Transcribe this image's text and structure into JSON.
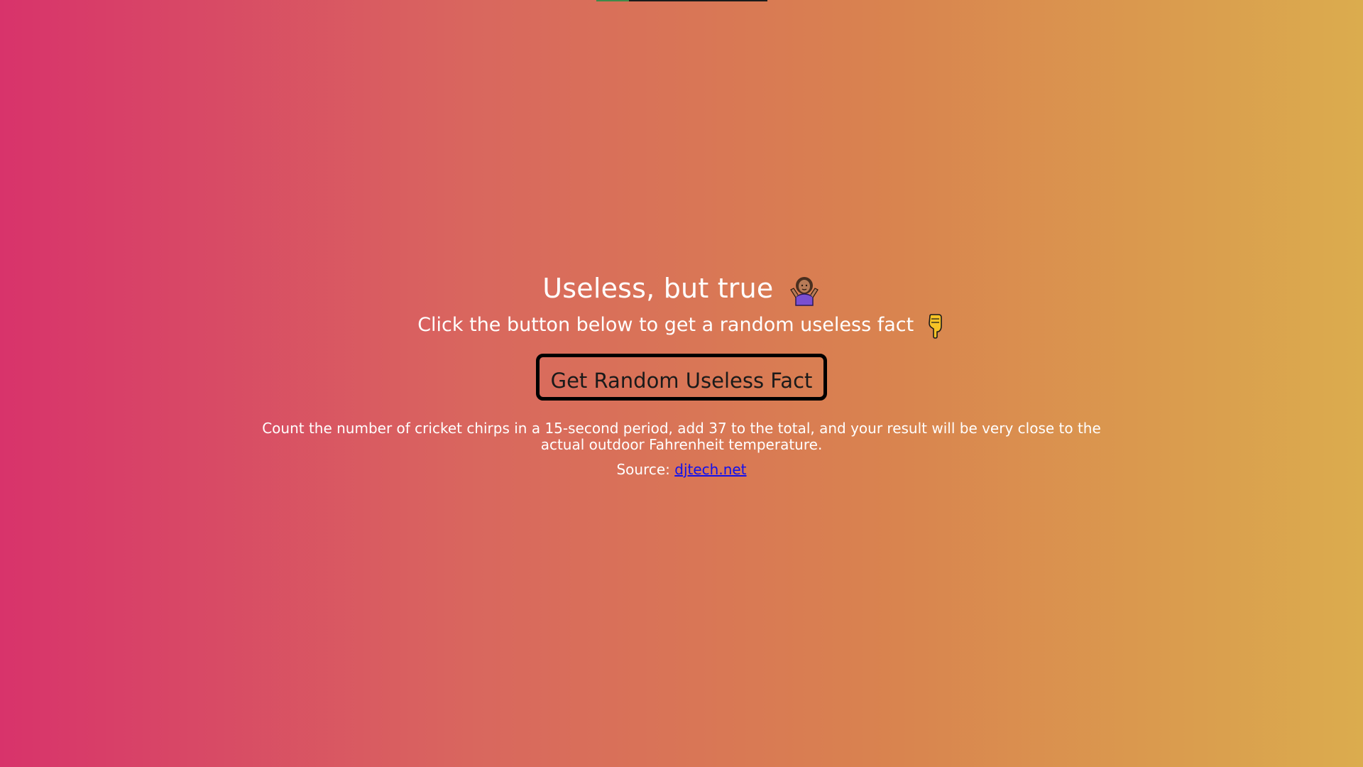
{
  "top_bar": {
    "progress_fraction": 0.19,
    "fill_color": "#3f8a49",
    "track_color": "#1b1b1b"
  },
  "header": {
    "title": "Useless, but true",
    "title_icon": "woman-shrugging-icon",
    "subtitle": "Click the button below to get a random useless fact",
    "subtitle_icon": "backhand-index-pointing-down-icon"
  },
  "button": {
    "label": "Get Random Useless Fact"
  },
  "fact": {
    "text": "Count the number of cricket chirps in a 15-second period, add 37 to the total, and your result will be very close to the actual outdoor Fahrenheit temperature.",
    "source_label": "Source:",
    "source_link_text": "djtech.net"
  },
  "colors": {
    "gradient_start": "#d8336b",
    "gradient_end": "#dbac4e",
    "link": "#1010ee",
    "button_border": "#000000"
  }
}
